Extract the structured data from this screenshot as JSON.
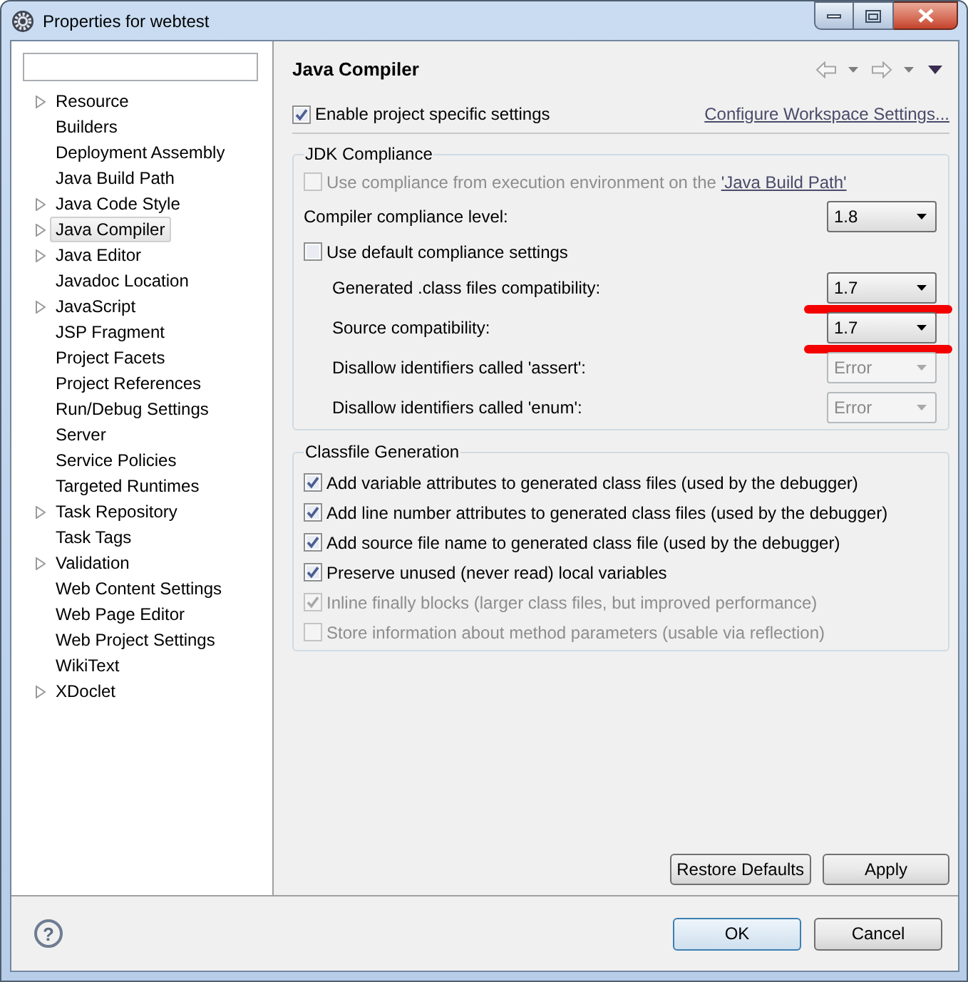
{
  "window": {
    "title": "Properties for webtest"
  },
  "tree": {
    "items": [
      {
        "label": "Resource",
        "expandable": true,
        "selected": false
      },
      {
        "label": "Builders",
        "expandable": false,
        "selected": false
      },
      {
        "label": "Deployment Assembly",
        "expandable": false,
        "selected": false
      },
      {
        "label": "Java Build Path",
        "expandable": false,
        "selected": false
      },
      {
        "label": "Java Code Style",
        "expandable": true,
        "selected": false
      },
      {
        "label": "Java Compiler",
        "expandable": true,
        "selected": true
      },
      {
        "label": "Java Editor",
        "expandable": true,
        "selected": false
      },
      {
        "label": "Javadoc Location",
        "expandable": false,
        "selected": false
      },
      {
        "label": "JavaScript",
        "expandable": true,
        "selected": false
      },
      {
        "label": "JSP Fragment",
        "expandable": false,
        "selected": false
      },
      {
        "label": "Project Facets",
        "expandable": false,
        "selected": false
      },
      {
        "label": "Project References",
        "expandable": false,
        "selected": false
      },
      {
        "label": "Run/Debug Settings",
        "expandable": false,
        "selected": false
      },
      {
        "label": "Server",
        "expandable": false,
        "selected": false
      },
      {
        "label": "Service Policies",
        "expandable": false,
        "selected": false
      },
      {
        "label": "Targeted Runtimes",
        "expandable": false,
        "selected": false
      },
      {
        "label": "Task Repository",
        "expandable": true,
        "selected": false
      },
      {
        "label": "Task Tags",
        "expandable": false,
        "selected": false
      },
      {
        "label": "Validation",
        "expandable": true,
        "selected": false
      },
      {
        "label": "Web Content Settings",
        "expandable": false,
        "selected": false
      },
      {
        "label": "Web Page Editor",
        "expandable": false,
        "selected": false
      },
      {
        "label": "Web Project Settings",
        "expandable": false,
        "selected": false
      },
      {
        "label": "WikiText",
        "expandable": false,
        "selected": false
      },
      {
        "label": "XDoclet",
        "expandable": true,
        "selected": false
      }
    ]
  },
  "page": {
    "title": "Java Compiler",
    "enable_project_settings": {
      "label": "Enable project specific settings",
      "checked": true
    },
    "workspace_link": "Configure Workspace Settings...",
    "jdk_compliance": {
      "title": "JDK Compliance",
      "rows": [
        {
          "kind": "checkbox",
          "label": "Use compliance from execution environment on the",
          "link": "'Java Build Path'",
          "checked": false,
          "disabled": true,
          "marked": false
        },
        {
          "kind": "select",
          "label": "Compiler compliance level:",
          "value": "1.8",
          "disabled": false,
          "marked": false
        },
        {
          "kind": "checkbox",
          "label": "Use default compliance settings",
          "checked": false,
          "disabled": false,
          "marked": false,
          "children": [
            {
              "kind": "select",
              "label": "Generated .class files compatibility:",
              "value": "1.7",
              "disabled": false,
              "marked": true
            },
            {
              "kind": "select",
              "label": "Source compatibility:",
              "value": "1.7",
              "disabled": false,
              "marked": true
            },
            {
              "kind": "select",
              "label": "Disallow identifiers called 'assert':",
              "value": "Error",
              "disabled": true,
              "marked": false
            },
            {
              "kind": "select",
              "label": "Disallow identifiers called 'enum':",
              "value": "Error",
              "disabled": true,
              "marked": false
            }
          ]
        }
      ]
    },
    "classfile_generation": {
      "title": "Classfile Generation",
      "options": [
        {
          "label": "Add variable attributes to generated class files (used by the debugger)",
          "checked": true,
          "disabled": false
        },
        {
          "label": "Add line number attributes to generated class files (used by the debugger)",
          "checked": true,
          "disabled": false
        },
        {
          "label": "Add source file name to generated class file (used by the debugger)",
          "checked": true,
          "disabled": false
        },
        {
          "label": "Preserve unused (never read) local variables",
          "checked": true,
          "disabled": false
        },
        {
          "label": "Inline finally blocks (larger class files, but improved performance)",
          "checked": true,
          "disabled": true
        },
        {
          "label": "Store information about method parameters (usable via reflection)",
          "checked": false,
          "disabled": true
        }
      ]
    },
    "buttons": [
      "Restore Defaults",
      "Apply"
    ]
  },
  "help": {
    "glyph": "?"
  },
  "dialog_buttons": [
    {
      "label": "OK",
      "default": true
    },
    {
      "label": "Cancel",
      "default": false
    }
  ]
}
